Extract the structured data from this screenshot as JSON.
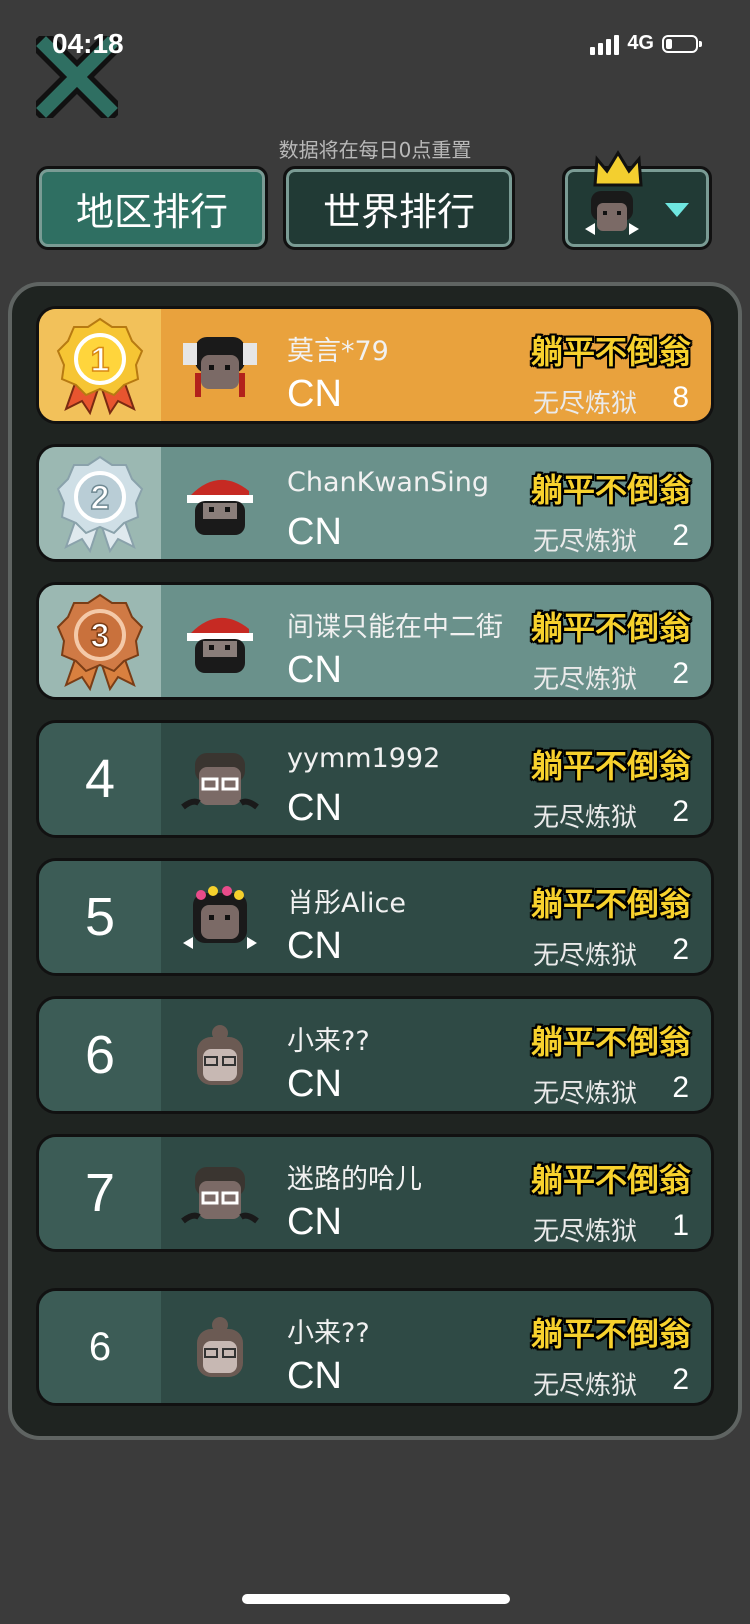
{
  "status_bar": {
    "time": "04:18",
    "network": "4G"
  },
  "notice": "数据将在每日0点重置",
  "tabs": [
    {
      "label": "地区排行"
    },
    {
      "label": "世界排行"
    }
  ],
  "colors": {
    "accent": "#2f6f62",
    "title_yellow": "#f7d12d",
    "caret": "#6fe6e0"
  },
  "rows": [
    {
      "rank": "1",
      "name": "莫言*79",
      "country": "CN",
      "title": "躺平不倒翁",
      "mode": "无尽炼狱",
      "score": "8"
    },
    {
      "rank": "2",
      "name": "ChanKwanSing",
      "country": "CN",
      "title": "躺平不倒翁",
      "mode": "无尽炼狱",
      "score": "2"
    },
    {
      "rank": "3",
      "name": "间谍只能在中二街",
      "country": "CN",
      "title": "躺平不倒翁",
      "mode": "无尽炼狱",
      "score": "2"
    },
    {
      "rank": "4",
      "name": "yymm1992",
      "country": "CN",
      "title": "躺平不倒翁",
      "mode": "无尽炼狱",
      "score": "2"
    },
    {
      "rank": "5",
      "name": "肖彤Alice",
      "country": "CN",
      "title": "躺平不倒翁",
      "mode": "无尽炼狱",
      "score": "2"
    },
    {
      "rank": "6",
      "name": "小来??",
      "country": "CN",
      "title": "躺平不倒翁",
      "mode": "无尽炼狱",
      "score": "2"
    },
    {
      "rank": "7",
      "name": "迷路的哈儿",
      "country": "CN",
      "title": "躺平不倒翁",
      "mode": "无尽炼狱",
      "score": "1"
    }
  ],
  "my_row": {
    "rank": "6",
    "name": "小来??",
    "country": "CN",
    "title": "躺平不倒翁",
    "mode": "无尽炼狱",
    "score": "2"
  }
}
